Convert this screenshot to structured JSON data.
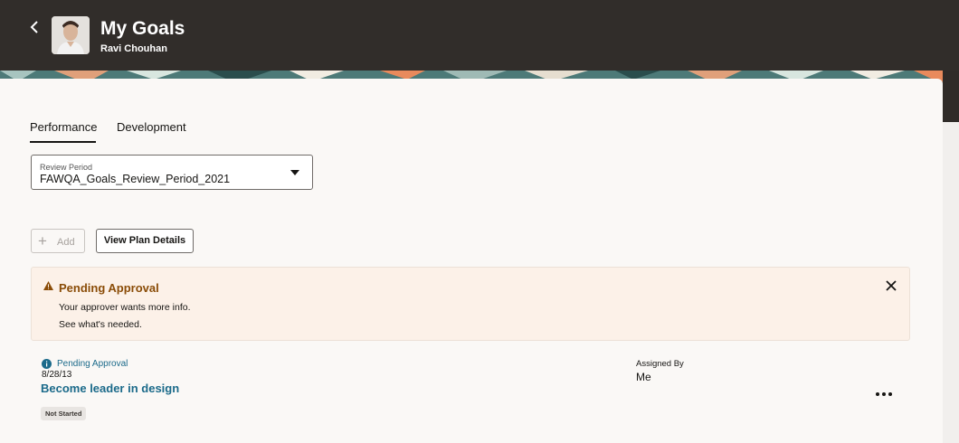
{
  "header": {
    "title": "My Goals",
    "subtitle": "Ravi Chouhan"
  },
  "tabs": [
    {
      "label": "Performance",
      "selected": true
    },
    {
      "label": "Development",
      "selected": false
    }
  ],
  "review_period": {
    "label": "Review Period",
    "value": "FAWQA_Goals_Review_Period_2021"
  },
  "toolbar": {
    "add_label": "Add",
    "view_plan_label": "View Plan Details"
  },
  "banner": {
    "title": "Pending Approval",
    "message": "Your approver wants more info.",
    "link": "See what's needed."
  },
  "goal": {
    "status": "Pending Approval",
    "date": "8/28/13",
    "title": "Become leader in design",
    "badge": "Not Started",
    "assigned_by_label": "Assigned By",
    "assigned_by_value": "Me"
  },
  "colors": {
    "header_bg": "#312d2a",
    "link_blue": "#1b6a8a",
    "warning_brown": "#8a4c07",
    "banner_bg": "#fcf1e8"
  }
}
